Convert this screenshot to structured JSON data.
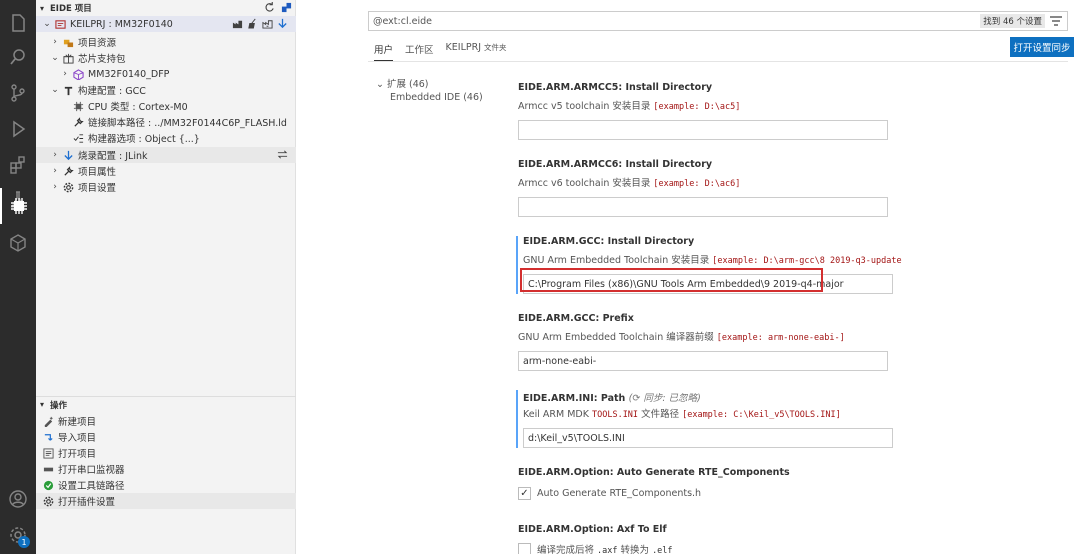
{
  "activity_bar": {
    "icons": [
      "explorer-icon",
      "search-icon",
      "source-control-icon",
      "run-debug-icon",
      "extensions-icon",
      "testing-icon",
      "eide-chip-icon",
      "cube-icon",
      "account-icon",
      "settings-gear-icon"
    ],
    "settings_badge": "1"
  },
  "sidebar": {
    "section1_title": "EIDE 项目",
    "project_name": "KEILPRJ : MM32F0140",
    "items": [
      {
        "label": "项目资源"
      },
      {
        "label": "芯片支持包"
      },
      {
        "label": "MM32F0140_DFP"
      },
      {
        "label": "构建配置 : GCC"
      },
      {
        "label": "CPU 类型 : Cortex-M0"
      },
      {
        "label": "链接脚本路径 : ../MM32F0144C6P_FLASH.ld"
      },
      {
        "label": "构建器选项 : Object {...}"
      },
      {
        "label": "烧录配置 : JLink"
      },
      {
        "label": "项目属性"
      },
      {
        "label": "项目设置"
      }
    ],
    "section2_title": "操作",
    "ops": [
      {
        "label": "新建项目"
      },
      {
        "label": "导入项目"
      },
      {
        "label": "打开项目"
      },
      {
        "label": "打开串口监视器"
      },
      {
        "label": "设置工具链路径"
      },
      {
        "label": "打开插件设置"
      }
    ]
  },
  "editor": {
    "search_value": "@ext:cl.eide",
    "search_count": "找到 46 个设置",
    "tabs": {
      "user": "用户",
      "workspace": "工作区",
      "folder": "KEILPRJ",
      "folder_suffix": "文件夹"
    },
    "sync_button": "打开设置同步",
    "toc": {
      "ext": "扩展 (46)",
      "sub": "Embedded IDE (46)"
    },
    "settings": [
      {
        "title_bold": "EIDE.ARM.ARMCC5: Install Directory",
        "desc": "Armcc v5 toolchain 安装目录 ",
        "example": "[example: D:\\ac5]",
        "value": ""
      },
      {
        "title_bold": "EIDE.ARM.ARMCC6: Install Directory",
        "desc": "Armcc v6 toolchain 安装目录 ",
        "example": "[example: D:\\ac6]",
        "value": ""
      },
      {
        "title_bold": "EIDE.ARM.GCC: Install Directory",
        "desc": "GNU Arm Embedded Toolchain 安装目录 ",
        "example": "[example: D:\\arm-gcc\\8 2019-q3-update",
        "value": "C:\\Program Files (x86)\\GNU Tools Arm Embedded\\9 2019-q4-major"
      },
      {
        "title_bold": "EIDE.ARM.GCC: Prefix",
        "desc": "GNU Arm Embedded Toolchain 编译器前缀 ",
        "example": "[example: arm-none-eabi-]",
        "value": "arm-none-eabi-"
      },
      {
        "title_bold": "EIDE.ARM.INI: Path",
        "sync_note": "同步: 已忽略",
        "desc_pre": "Keil ARM MDK ",
        "desc_code": "TOOLS.INI",
        "desc": " 文件路径 ",
        "example": "[example: C:\\Keil_v5\\TOOLS.INI]",
        "value": "d:\\Keil_v5\\TOOLS.INI"
      },
      {
        "title_bold": "EIDE.ARM.Option:",
        "title_plain": " Auto Generate RTE_Components",
        "check_label": "Auto Generate RTE_Components.h"
      },
      {
        "title_bold": "EIDE.ARM.Option:",
        "title_plain": " Axf To Elf",
        "desc_pre": "编译完成后将 ",
        "code1": ".axf",
        "mid": " 转换为 ",
        "code2": ".elf"
      }
    ]
  },
  "colors": {
    "accent": "#0e70c0",
    "highlight_box": "#d32f2f",
    "activity_bg": "#2c2c2c"
  }
}
